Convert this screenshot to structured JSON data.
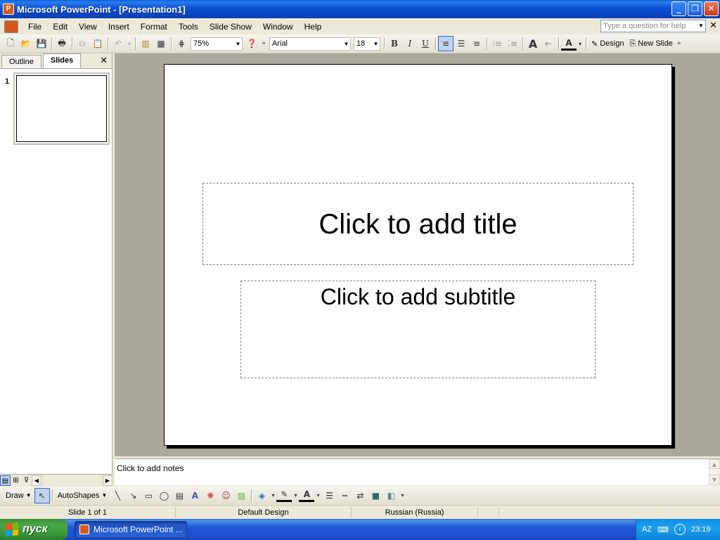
{
  "window": {
    "title": "Microsoft PowerPoint - [Presentation1]"
  },
  "menubar": {
    "items": [
      "File",
      "Edit",
      "View",
      "Insert",
      "Format",
      "Tools",
      "Slide Show",
      "Window",
      "Help"
    ],
    "help_placeholder": "Type a question for help"
  },
  "toolbar": {
    "zoom": "75%",
    "font": "Arial",
    "font_size": "18",
    "bold": "B",
    "italic": "I",
    "underline": "U",
    "design_label": "Design",
    "new_slide_label": "New Slide"
  },
  "leftpane": {
    "tabs": [
      "Outline",
      "Slides"
    ],
    "active_tab": "Slides",
    "slide_number": "1"
  },
  "slide": {
    "title_placeholder": "Click to add title",
    "subtitle_placeholder": "Click to add subtitle"
  },
  "notes": {
    "placeholder": "Click to add notes"
  },
  "drawbar": {
    "draw_label": "Draw",
    "autoshapes_label": "AutoShapes"
  },
  "statusbar": {
    "slide_pos": "Slide 1 of 1",
    "design": "Default Design",
    "language": "Russian (Russia)"
  },
  "taskbar": {
    "start_label": "пуск",
    "task_label": "Microsoft PowerPoint ...",
    "lang": "AZ",
    "clock": "23:19"
  },
  "colors": {
    "title_bar": "#0a4fd1",
    "start_green": "#3a9a38",
    "tray_blue": "#1aa0f0",
    "workspace": "#aaa89a"
  }
}
